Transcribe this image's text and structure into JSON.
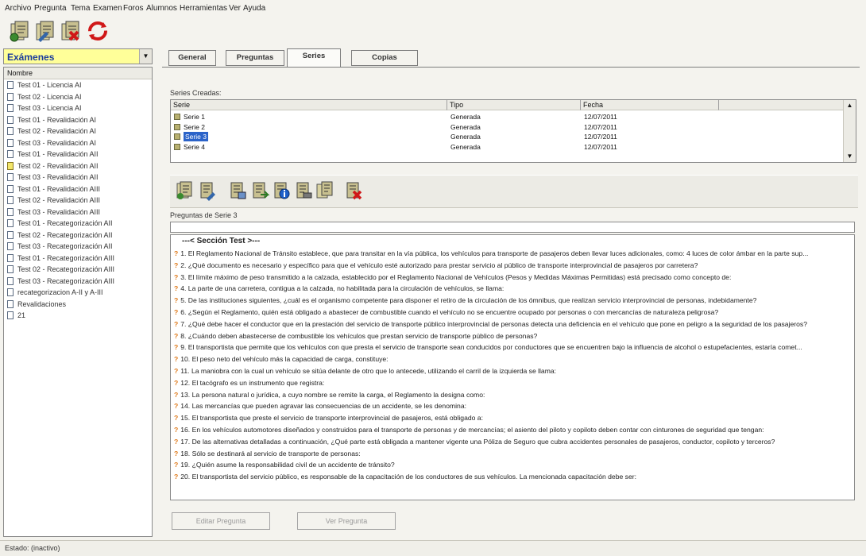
{
  "menu": [
    "Archivo",
    "Pregunta",
    "Tema",
    "Examen",
    "Foros",
    "Alumnos",
    "Herramientas",
    "Ver",
    "Ayuda"
  ],
  "toolbar": {
    "icons": [
      "new-exam-icon",
      "edit-exam-icon",
      "delete-exam-icon",
      "refresh-icon"
    ]
  },
  "exams": {
    "combo_label": "Exámenes",
    "list_header": "Nombre",
    "items": [
      "Test 01 - Licencia AI",
      "Test 02 - Licencia AI",
      "Test 03 - Licencia AI",
      "Test 01 - Revalidación AI",
      "Test 02 - Revalidación AI",
      "Test 03 - Revalidación AI",
      "Test 01 - Revalidación AII",
      "Test 02 - Revalidación AII",
      "Test 03 - Revalidación AII",
      "Test 01 - Revalidación AIII",
      "Test 02 - Revalidación AIII",
      "Test 03 - Revalidación AIII",
      "Test 01 - Recategorización AII",
      "Test 02 - Recategorización AII",
      "Test 03 - Recategorización AII",
      "Test 01 - Recategorización AIII",
      "Test 02 - Recategorización AIII",
      "Test 03 - Recategorización AIII",
      "recategorizacion A-II y A-III",
      "Revalidaciones",
      "21"
    ]
  },
  "tabs": [
    "General",
    "Preguntas",
    "Series",
    "Copias"
  ],
  "series": {
    "caption": "Series Creadas:",
    "columns": [
      "Serie",
      "Tipo",
      "Fecha"
    ],
    "rows": [
      {
        "name": "Serie 1",
        "type": "Generada",
        "date": "12/07/2011"
      },
      {
        "name": "Serie 2",
        "type": "Generada",
        "date": "12/07/2011"
      },
      {
        "name": "Serie 3",
        "type": "Generada",
        "date": "12/07/2011"
      },
      {
        "name": "Serie 4",
        "type": "Generada",
        "date": "12/07/2011"
      }
    ]
  },
  "questions": {
    "caption": "Preguntas de Serie 3",
    "section": "---< Sección Test >---",
    "items": [
      "1. El Reglamento Nacional de Tránsito establece, que para transitar en la vía pública, los vehículos para transporte de pasajeros deben llevar luces adicionales, como: 4 luces de color ámbar en la parte sup...",
      "2. ¿Qué documento es necesario y específico para que el vehículo esté autorizado para prestar servicio al público de transporte interprovincial de pasajeros por carretera?",
      "3. El límite máximo de peso transmitido a la calzada, establecido por el Reglamento Nacional de Vehículos (Pesos y Medidas Máximas Permitidas) está precisado como concepto de:",
      "4. La parte de una carretera, contigua a la calzada, no habilitada para la circulación de vehículos, se llama:",
      "5. De las instituciones siguientes, ¿cuál es el organismo competente para disponer el retiro de la circulación de los ómnibus, que realizan servicio interprovincial de personas, indebidamente?",
      "6. ¿Según el Reglamento, quién está obligado a abastecer de combustible cuando el vehículo no se encuentre ocupado por personas o con mercancías de naturaleza peligrosa?",
      "7. ¿Qué debe hacer el conductor que en la prestación del servicio de transporte público interprovincial de personas detecta una deficiencia en el vehículo que pone en peligro a la seguridad de los pasajeros?",
      "8. ¿Cuándo deben abastecerse de combustible los vehículos que prestan servicio de transporte público de personas?",
      "9. El transportista que permite que los vehículos con que presta el servicio de transporte sean conducidos por conductores que se encuentren bajo la influencia de alcohol o estupefacientes, estaría comet...",
      "10. El peso neto del vehículo más la capacidad de carga, constituye:",
      "11. La maniobra con la cual un vehículo se sitúa delante de otro que lo antecede, utilizando el carril de la izquierda se llama:",
      "12. El tacógrafo es un instrumento que registra:",
      "13. La persona natural o jurídica, a cuyo nombre se remite la carga, el Reglamento la designa como:",
      "14. Las mercancías que pueden agravar las consecuencias de un accidente, se les denomina:",
      "15. El transportista que preste el servicio de transporte interprovincial de pasajeros, está obligado a:",
      "16. En los vehículos automotores diseñados y construidos para el transporte de personas y de mercancías; el asiento del piloto y copiloto deben contar con cinturones de seguridad que tengan:",
      "17. De las alternativas detalladas a continuación, ¿Qué parte está obligada a mantener vigente una Póliza de Seguro que cubra accidentes personales de pasajeros, conductor, copiloto y terceros?",
      "18. Sólo se destinará al servicio de transporte de personas:",
      "19. ¿Quién asume la responsabilidad civil de un accidente de tránsito?",
      "20. El transportista del servicio público, es responsable de la capacitación de los conductores de sus vehículos. La mencionada capacitación debe ser:"
    ]
  },
  "buttons": {
    "edit": "Editar Pregunta",
    "view": "Ver Pregunta"
  },
  "status": "Estado: (inactivo)"
}
